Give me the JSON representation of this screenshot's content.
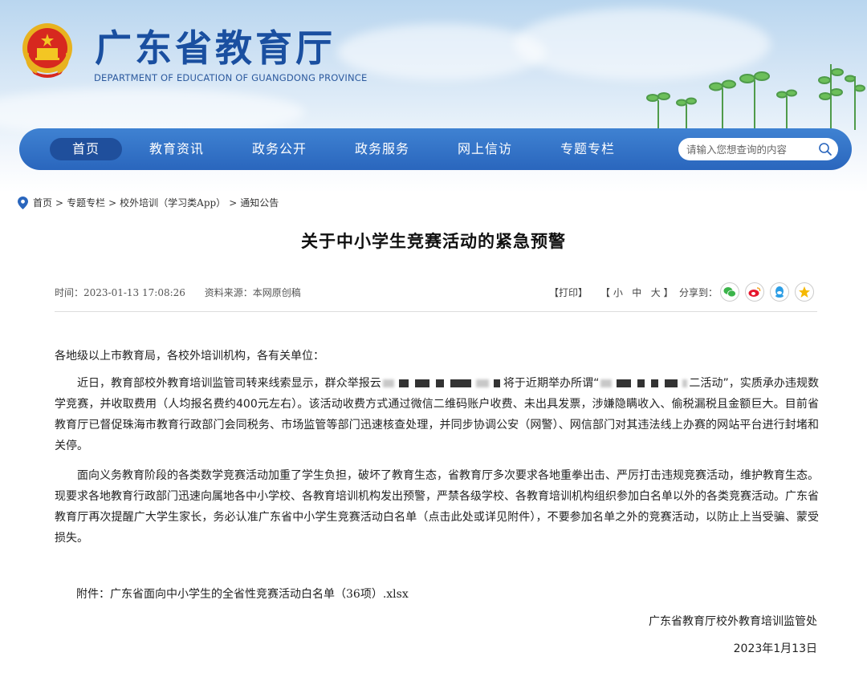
{
  "header": {
    "title": "广东省教育厅",
    "subtitle": "DEPARTMENT OF EDUCATION OF GUANGDONG PROVINCE"
  },
  "nav": {
    "items": [
      "首页",
      "教育资讯",
      "政务公开",
      "政务服务",
      "网上信访",
      "专题专栏"
    ],
    "active": "首页",
    "search_placeholder": "请输入您想查询的内容"
  },
  "breadcrumb": [
    "首页",
    "专题专栏",
    "校外培训（学习类App）",
    "通知公告"
  ],
  "article": {
    "title": "关于中小学生竞赛活动的紧急预警",
    "time_label": "时间：2023-01-13 17:08:26",
    "source_label": "资料来源：本网原创稿",
    "print": "【打印】",
    "font_size_controls": "【 小   中   大 】",
    "share_label": "分享到：",
    "salutation": "各地级以上市教育局，各校外培训机构，各有关单位：",
    "p1_a": "近日，教育部校外教育培训监管司转来线索显示，群众举报云",
    "p1_b": "将于近期举办所谓“",
    "p1_c": "二活动”，实质承办违规数学竞赛，并收取费用（人均报名费约400元左右）。该活动收费方式通过微信二维码账户收费、未出具发票，涉嫌隐瞒收入、偷税漏税且金额巨大。目前省教育厅已督促珠海市教育行政部门会同税务、市场监管等部门迅速核查处理，并同步协调公安（网警）、网信部门对其违法线上办赛的网站平台进行封堵和关停。",
    "p2": "面向义务教育阶段的各类数学竞赛活动加重了学生负担，破坏了教育生态，省教育厅多次要求各地重拳出击、严厉打击违规竞赛活动，维护教育生态。现要求各地教育行政部门迅速向属地各中小学校、各教育培训机构发出预警，严禁各级学校、各教育培训机构组织参加白名单以外的各类竞赛活动。广东省教育厅再次提醒广大学生家长，务必认准广东省中小学生竞赛活动白名单（点击此处或详见附件），不要参加名单之外的竞赛活动，以防止上当受骗、蒙受损失。",
    "attachment_label": "附件：",
    "attachment_file": "广东省面向中小学生的全省性竞赛活动白名单（36项）.xlsx",
    "signature": "广东省教育厅校外教育培训监管处",
    "date": "2023年1月13日"
  },
  "colors": {
    "brand_blue": "#1a4fa0",
    "nav_blue": "#2a66bd",
    "nav_active": "#1f4f9c",
    "wechat": "#3bb44a",
    "weibo": "#e6162d",
    "qq": "#2b9de5",
    "qzone": "#f5b800"
  },
  "icons": [
    "national-emblem-icon",
    "search-icon",
    "location-pin-icon",
    "wechat-icon",
    "weibo-icon",
    "qq-icon",
    "qzone-icon"
  ]
}
